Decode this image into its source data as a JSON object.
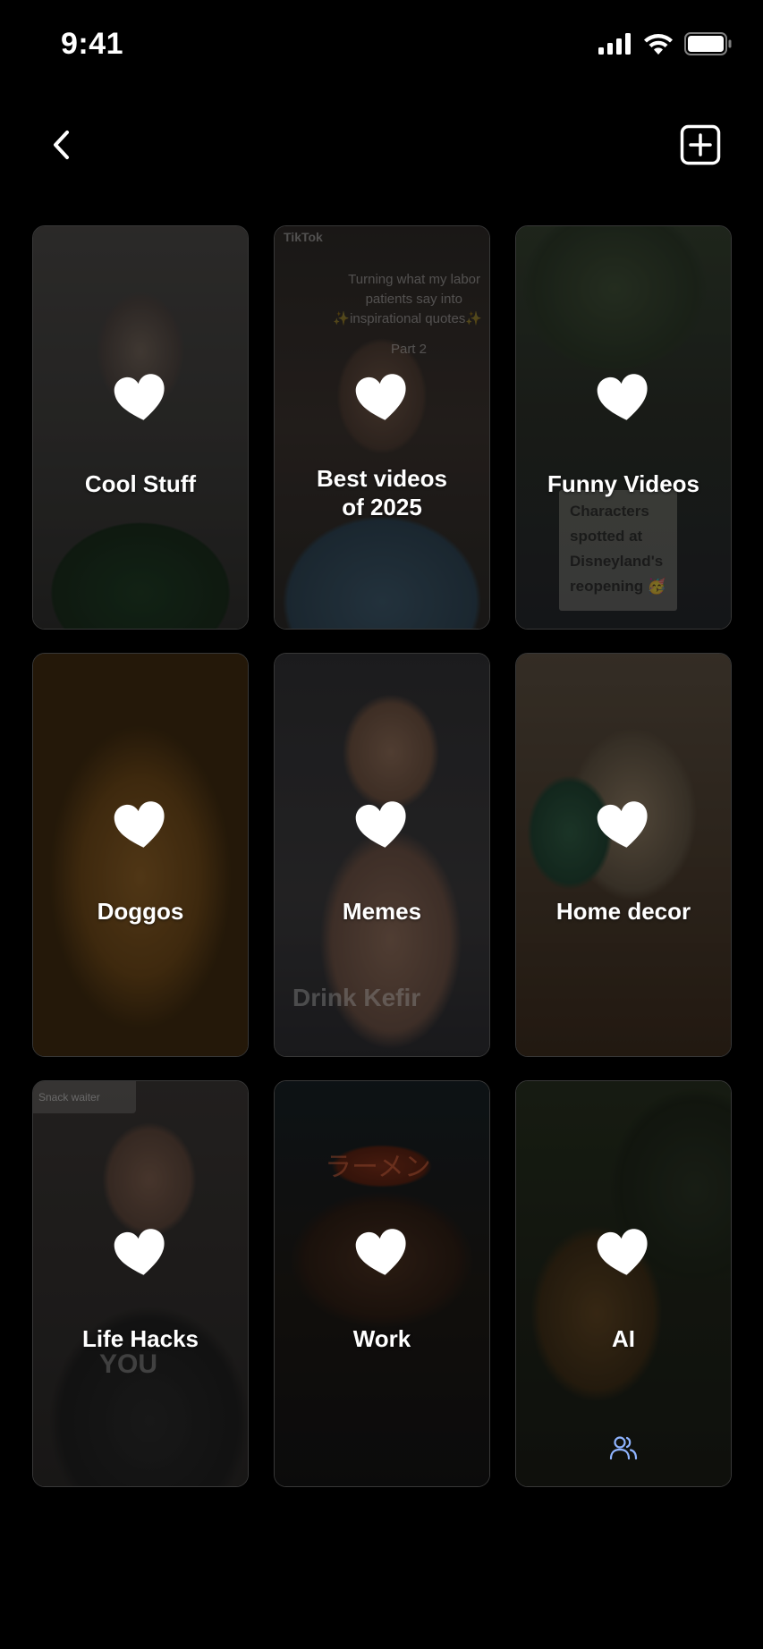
{
  "status_bar": {
    "time": "9:41"
  },
  "header": {
    "back_icon": "chevron-left-icon",
    "add_icon": "plus-square-icon"
  },
  "collections": [
    {
      "label": "Cool Stuff",
      "shared": false
    },
    {
      "label": "Best videos\nof 2025",
      "shared": false,
      "thumb_text": [
        "TikTok",
        "Turning what my labor",
        "patients say into",
        "✨inspirational quotes✨",
        "Part 2"
      ]
    },
    {
      "label": "Funny Videos",
      "shared": false,
      "thumb_text": [
        "Characters",
        "spotted at",
        "Disneyland's",
        "reopening 🥳"
      ]
    },
    {
      "label": "Doggos",
      "shared": false
    },
    {
      "label": "Memes",
      "shared": false,
      "thumb_text": [
        "Drink Kefir"
      ]
    },
    {
      "label": "Home decor",
      "shared": false
    },
    {
      "label": "Life Hacks",
      "shared": false,
      "thumb_text": [
        "Snack waiter",
        "YOU"
      ]
    },
    {
      "label": "Work",
      "shared": false,
      "thumb_text": [
        "ラーメン"
      ]
    },
    {
      "label": "AI",
      "shared": true
    }
  ],
  "colors": {
    "background": "#000000",
    "text": "#ffffff",
    "shared_icon": "#8fb4ff"
  }
}
